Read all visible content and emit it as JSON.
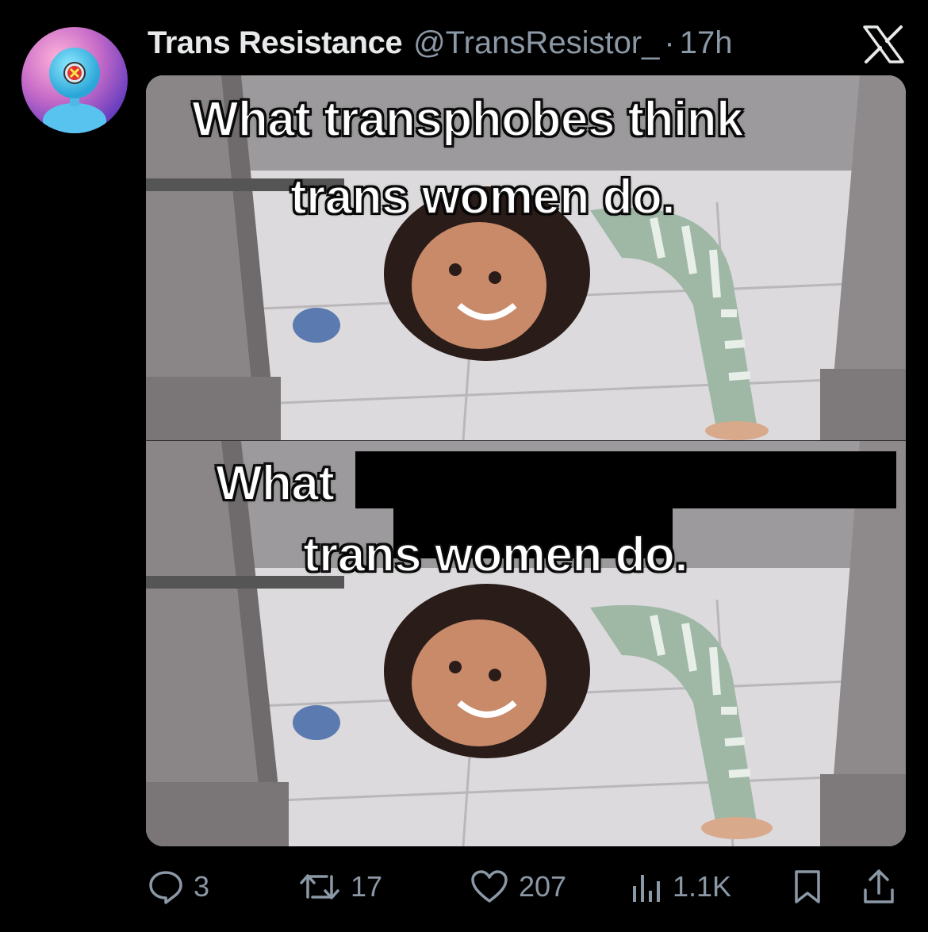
{
  "tweet": {
    "display_name": "Trans Resistance",
    "handle": "@TransResistor_",
    "separator": "·",
    "time": "17h",
    "platform_icon": "x-logo-icon",
    "avatar_icon": "robot-avatar-icon"
  },
  "media": {
    "top_caption_line1": "What transphobes think",
    "top_caption_line2": "trans women do.",
    "bottom_caption_line1": "What",
    "bottom_caption_line2": "trans women do.",
    "redaction_color": "#000000"
  },
  "actions": {
    "reply": {
      "icon": "reply-icon",
      "count": "3"
    },
    "repost": {
      "icon": "repost-icon",
      "count": "17"
    },
    "like": {
      "icon": "heart-icon",
      "count": "207"
    },
    "views": {
      "icon": "views-icon",
      "count": "1.1K"
    },
    "bookmark": {
      "icon": "bookmark-icon"
    },
    "share": {
      "icon": "share-icon"
    }
  },
  "colors": {
    "background": "#000000",
    "primary_text": "#e7e9ea",
    "secondary_text": "#8b98a5"
  }
}
